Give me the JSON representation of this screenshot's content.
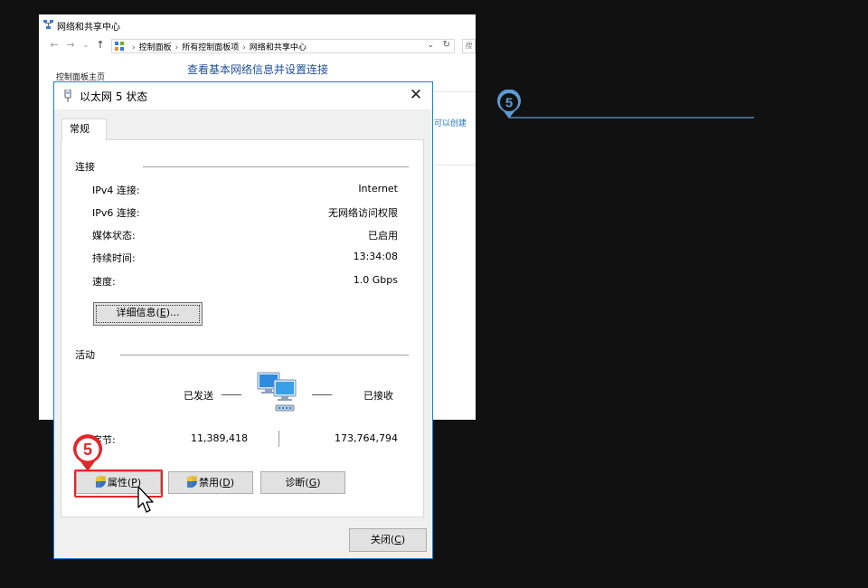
{
  "explorer": {
    "title": "网络和共享中心",
    "breadcrumbs": [
      "控制面板",
      "所有控制面板项",
      "网络和共享中心"
    ],
    "search_stub": "搜",
    "sidebar_home": "控制面板主页",
    "heading": "查看基本网络信息并设置连接",
    "right_link": "可以创建"
  },
  "dialog": {
    "title": "以太网 5 状态",
    "tab": "常规",
    "connection": {
      "group_label": "连接",
      "rows": [
        {
          "label": "IPv4 连接:",
          "value": "Internet"
        },
        {
          "label": "IPv6 连接:",
          "value": "无网络访问权限"
        },
        {
          "label": "媒体状态:",
          "value": "已启用"
        },
        {
          "label": "持续时间:",
          "value": "13:34:08"
        },
        {
          "label": "速度:",
          "value": "1.0 Gbps"
        }
      ],
      "details_button": {
        "text": "详细信息(",
        "key": "E",
        "suffix": ")..."
      }
    },
    "activity": {
      "group_label": "活动",
      "sent_label": "已发送",
      "received_label": "已接收",
      "bytes_label": "字节:",
      "bytes_sent": "11,389,418",
      "bytes_received": "173,764,794"
    },
    "buttons": {
      "properties": {
        "text": "属性(",
        "key": "P",
        "suffix": ")"
      },
      "disable": {
        "text": "禁用(",
        "key": "D",
        "suffix": ")"
      },
      "diagnose": {
        "text": "诊断(",
        "key": "G",
        "suffix": ")"
      },
      "close": {
        "text": "关闭(",
        "key": "C",
        "suffix": ")"
      }
    }
  },
  "annotations": {
    "red_step": "5",
    "blue_step": "5",
    "highlight_color": "#e3262b",
    "blue_color": "#5b9bd5"
  }
}
